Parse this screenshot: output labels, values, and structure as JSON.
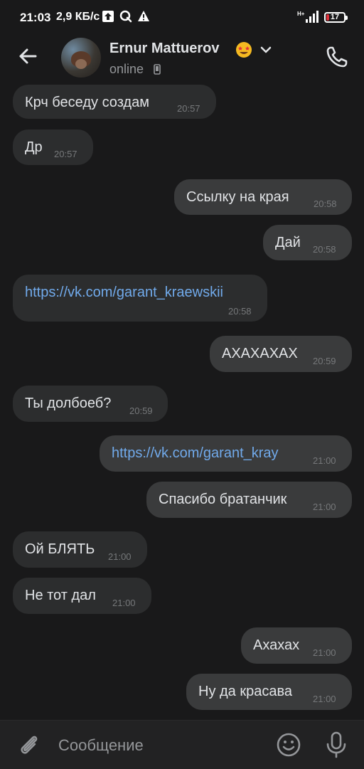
{
  "status_bar": {
    "time": "21:03",
    "speed": "2,9 КБ/с",
    "battery_level": "17",
    "network": "H+"
  },
  "header": {
    "contact_name": "Ernur Mattuerov",
    "status": "online",
    "emoji": "star-struck-emoji"
  },
  "messages": [
    {
      "text": "Крч беседу создам",
      "time": "20:57",
      "direction": "in"
    },
    {
      "text": "Др",
      "time": "20:57",
      "direction": "in"
    },
    {
      "text": "Ссылку на края",
      "time": "20:58",
      "direction": "out"
    },
    {
      "text": "Дай",
      "time": "20:58",
      "direction": "out"
    },
    {
      "text": "https://vk.com/garant_kraewskii",
      "time": "20:58",
      "direction": "in",
      "link": true
    },
    {
      "text": "АХАХАХАХ",
      "time": "20:59",
      "direction": "out"
    },
    {
      "text": "Ты долбоеб?",
      "time": "20:59",
      "direction": "in"
    },
    {
      "text": "https://vk.com/garant_kray",
      "time": "21:00",
      "direction": "out",
      "link": true
    },
    {
      "text": "Спасибо братанчик",
      "time": "21:00",
      "direction": "out"
    },
    {
      "text": "Ой БЛЯТЬ",
      "time": "21:00",
      "direction": "in"
    },
    {
      "text": "Не тот дал",
      "time": "21:00",
      "direction": "in"
    },
    {
      "text": "Ахахах",
      "time": "21:00",
      "direction": "out"
    },
    {
      "text": "Ну да красава",
      "time": "21:00",
      "direction": "out"
    }
  ],
  "composer": {
    "placeholder": "Сообщение"
  },
  "colors": {
    "background": "#19191a",
    "incoming_bubble": "#2c2d2e",
    "outgoing_bubble": "#3a3b3c",
    "link": "#71aaeb",
    "muted": "#949699"
  }
}
